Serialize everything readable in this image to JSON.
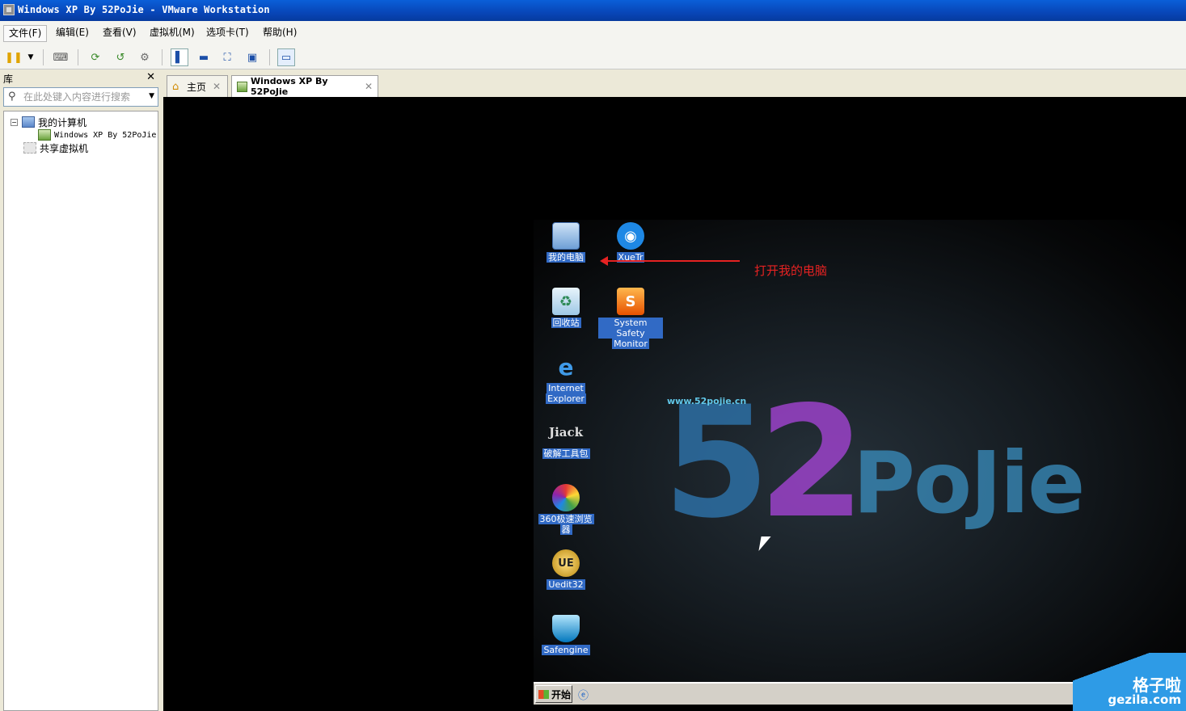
{
  "window": {
    "title": "Windows XP By 52PoJie - VMware Workstation"
  },
  "menubar": {
    "items": [
      "文件(F)",
      "编辑(E)",
      "查看(V)",
      "虚拟机(M)",
      "选项卡(T)",
      "帮助(H)"
    ]
  },
  "library": {
    "title": "库",
    "search_placeholder": "在此处键入内容进行搜索",
    "tree": {
      "my_computer": "我的计算机",
      "vm": "Windows XP By 52PoJie",
      "shared": "共享虚拟机"
    }
  },
  "tabs": [
    {
      "label": "主页"
    },
    {
      "label": "Windows XP By 52PoJie"
    }
  ],
  "desktop": {
    "icons": {
      "my_computer": "我的电脑",
      "xuetr": "XueTr",
      "recycle_bin": "回收站",
      "system_safety_1": "System Safety",
      "system_safety_2": "Monitor",
      "ie_1": "Internet",
      "ie_2": "Explorer",
      "jiack_logo": "Jiack",
      "toolkit": "破解工具包",
      "browser360_1": "360极速浏览",
      "browser360_2": "器",
      "uedit_logo": "UE",
      "uedit": "Uedit32",
      "safengine": "Safengine"
    },
    "annotation": "打开我的电脑",
    "wallpaper": {
      "five": "5",
      "two": "2",
      "pojie": "PoJie",
      "url": "www.52pojie.cn"
    }
  },
  "taskbar": {
    "start": "开始"
  },
  "watermark": {
    "line1": "格子啦",
    "line2": "gezila.com"
  },
  "colors": {
    "titlebar": "#0846b8",
    "selection": "#316ac5",
    "annotation": "#e52222"
  }
}
